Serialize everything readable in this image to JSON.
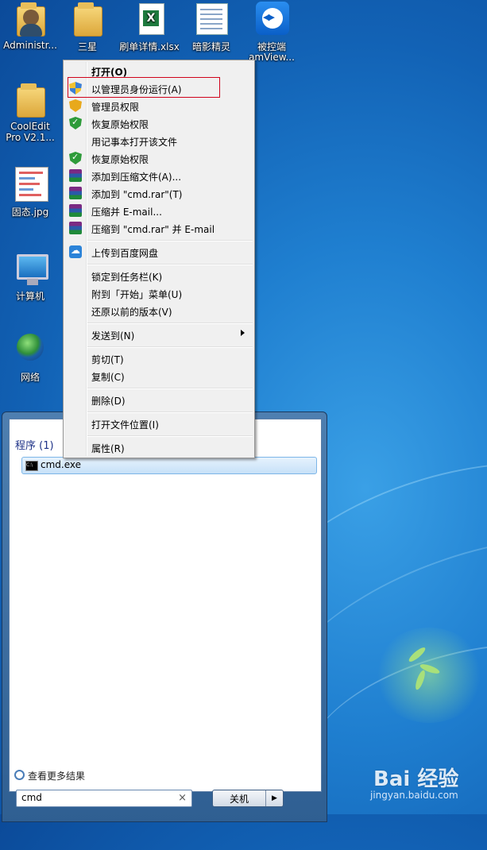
{
  "desktop": {
    "icons": [
      {
        "label": "Administr...",
        "icon": "user-folder-icon"
      },
      {
        "label": "三星",
        "icon": "folder-icon"
      },
      {
        "label": "刷单详情.xlsx",
        "icon": "excel-file-icon"
      },
      {
        "label": "暗影精灵",
        "icon": "document-icon"
      },
      {
        "label": "被控端",
        "icon": "teamviewer-icon"
      },
      {
        "label": "amView...",
        "icon": "teamviewer-icon"
      },
      {
        "label": "CoolEdit",
        "icon": "folder-icon"
      },
      {
        "label": "Pro V2.1...",
        "icon": "folder-icon"
      },
      {
        "label": "固态.jpg",
        "icon": "image-file-icon"
      },
      {
        "label": "计算机",
        "icon": "computer-icon"
      },
      {
        "label": "网络",
        "icon": "network-icon"
      }
    ]
  },
  "context_menu": {
    "items": [
      {
        "label": "打开(O)",
        "icon": ""
      },
      {
        "label": "以管理员身份运行(A)",
        "icon": "uac-shield-icon"
      },
      {
        "label": "管理员权限",
        "icon": "admin-shield-icon"
      },
      {
        "label": "恢复原始权限",
        "icon": "green-shield-icon"
      },
      {
        "label": "用记事本打开该文件",
        "icon": ""
      },
      {
        "label": "恢复原始权限",
        "icon": "green-shield-icon"
      },
      {
        "label": "添加到压缩文件(A)...",
        "icon": "winrar-icon"
      },
      {
        "label": "添加到 \"cmd.rar\"(T)",
        "icon": "winrar-icon"
      },
      {
        "label": "压缩并 E-mail...",
        "icon": "winrar-icon"
      },
      {
        "label": "压缩到 \"cmd.rar\" 并 E-mail",
        "icon": "winrar-icon"
      },
      {
        "label": "上传到百度网盘",
        "icon": "baidu-netdisk-icon"
      },
      {
        "label": "锁定到任务栏(K)",
        "icon": ""
      },
      {
        "label": "附到「开始」菜单(U)",
        "icon": ""
      },
      {
        "label": "还原以前的版本(V)",
        "icon": ""
      },
      {
        "label": "发送到(N)",
        "icon": "submenu-arrow-icon"
      },
      {
        "label": "剪切(T)",
        "icon": ""
      },
      {
        "label": "复制(C)",
        "icon": ""
      },
      {
        "label": "删除(D)",
        "icon": ""
      },
      {
        "label": "打开文件位置(I)",
        "icon": ""
      },
      {
        "label": "属性(R)",
        "icon": ""
      }
    ]
  },
  "start_menu": {
    "programs_header": "程序 (1)",
    "result_label": "cmd.exe",
    "see_more": "查看更多结果",
    "search_value": "cmd",
    "clear_icon": "×",
    "shutdown_label": "关机",
    "shutdown_arrow": "▶"
  },
  "watermark": {
    "text": "Bai 经验",
    "sub": "jingyan.baidu.com"
  },
  "colors": {
    "highlight_border": "#d0021b",
    "selection_bg": "#c7e1f8",
    "desktop_bg": "#1f7fd0"
  }
}
